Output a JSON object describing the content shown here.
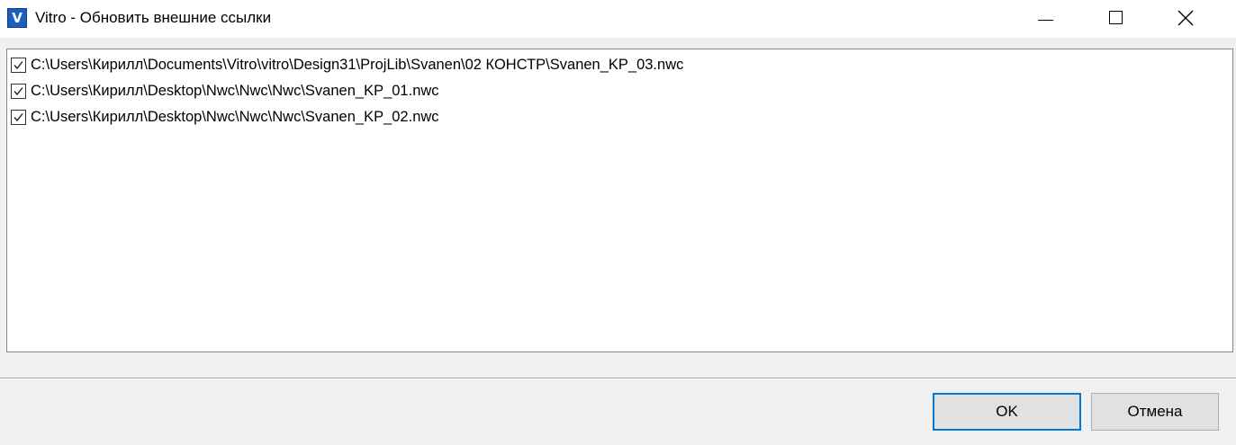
{
  "window": {
    "title": "Vitro - Обновить внешние ссылки",
    "app_icon_letter": "V",
    "accent_color": "#0078d7"
  },
  "links": [
    {
      "checked": true,
      "path": "C:\\Users\\Кирилл\\Documents\\Vitro\\vitro\\Design31\\ProjLib\\Svanen\\02 КОНСТР\\Svanen_KP_03.nwc"
    },
    {
      "checked": true,
      "path": "C:\\Users\\Кирилл\\Desktop\\Nwc\\Nwc\\Nwc\\Svanen_KP_01.nwc"
    },
    {
      "checked": true,
      "path": "C:\\Users\\Кирилл\\Desktop\\Nwc\\Nwc\\Nwc\\Svanen_KP_02.nwc"
    }
  ],
  "buttons": {
    "ok_label": "OK",
    "cancel_label": "Отмена"
  }
}
